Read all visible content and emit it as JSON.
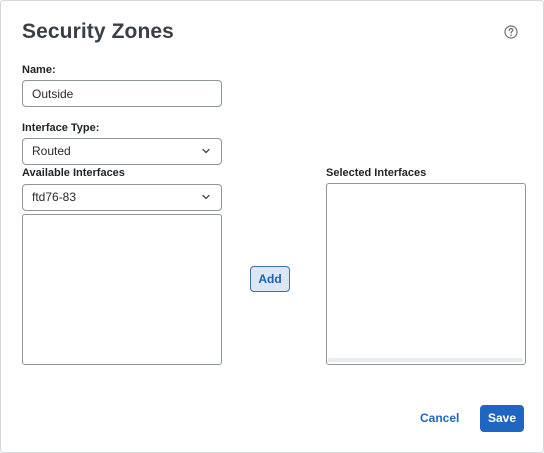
{
  "dialog": {
    "title": "Security Zones",
    "help_icon": "help-circle-icon"
  },
  "form": {
    "name_label": "Name:",
    "name_value": "Outside",
    "interface_type_label": "Interface Type:",
    "interface_type_value": "Routed",
    "available_interfaces_label": "Available Interfaces",
    "device_select_value": "ftd76-83",
    "selected_interfaces_label": "Selected Interfaces",
    "available_list": [],
    "selected_list": []
  },
  "actions": {
    "add_label": "Add",
    "cancel_label": "Cancel",
    "save_label": "Save"
  },
  "colors": {
    "primary": "#1f66c2",
    "add_button_bg": "#dbe7f7",
    "border": "#8f959b",
    "title": "#3a3f45"
  }
}
